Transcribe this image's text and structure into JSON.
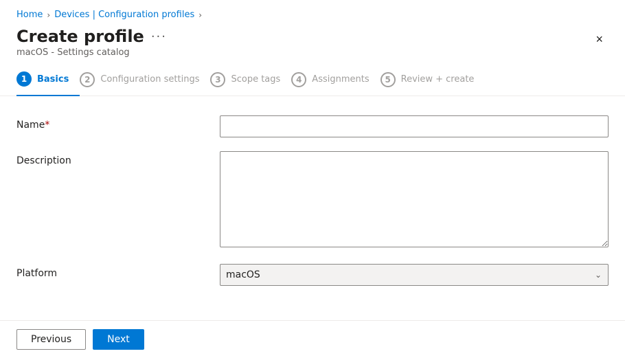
{
  "breadcrumb": {
    "items": [
      {
        "label": "Home",
        "id": "home"
      },
      {
        "label": "Devices | Configuration profiles",
        "id": "devices-config"
      }
    ],
    "separators": [
      ">",
      ">"
    ]
  },
  "header": {
    "title": "Create profile",
    "more_icon": "···",
    "subtitle": "macOS - Settings catalog",
    "close_icon": "×"
  },
  "steps": [
    {
      "number": "1",
      "label": "Basics",
      "active": true
    },
    {
      "number": "2",
      "label": "Configuration settings",
      "active": false
    },
    {
      "number": "3",
      "label": "Scope tags",
      "active": false
    },
    {
      "number": "4",
      "label": "Assignments",
      "active": false
    },
    {
      "number": "5",
      "label": "Review + create",
      "active": false
    }
  ],
  "form": {
    "name_label": "Name",
    "name_required": "*",
    "name_placeholder": "",
    "description_label": "Description",
    "description_placeholder": "",
    "platform_label": "Platform",
    "platform_value": "macOS",
    "platform_options": [
      "macOS"
    ]
  },
  "footer": {
    "previous_label": "Previous",
    "next_label": "Next"
  }
}
